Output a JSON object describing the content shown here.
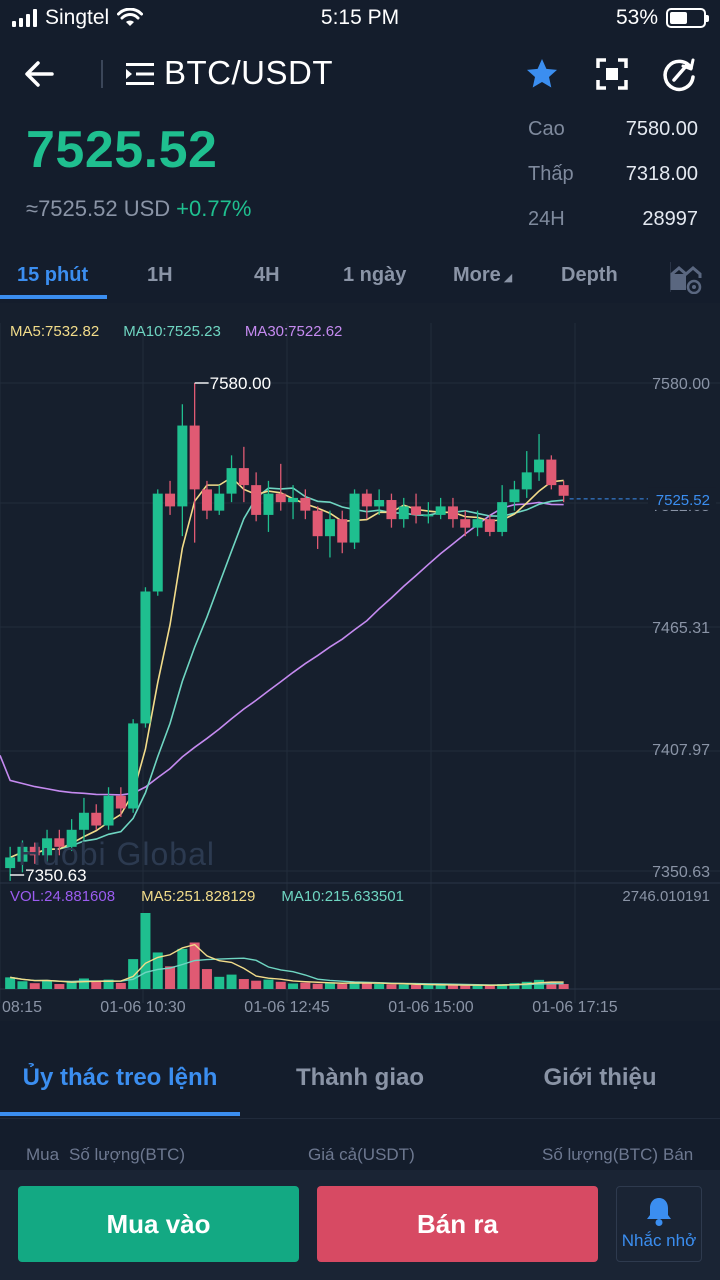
{
  "status_bar": {
    "carrier": "Singtel",
    "time": "5:15 PM",
    "battery": "53%",
    "battery_level": 0.53
  },
  "header": {
    "pair": "BTC/USDT",
    "favorited": true
  },
  "ticker": {
    "price": "7525.52",
    "usd_value": "≈7525.52 USD",
    "change": "+0.77%",
    "stats": [
      {
        "label": "Cao",
        "value": "7580.00"
      },
      {
        "label": "Thấp",
        "value": "7318.00"
      },
      {
        "label": "24H",
        "value": "28997"
      }
    ]
  },
  "tabs": [
    "15 phút",
    "1H",
    "4H",
    "1 ngày",
    "More",
    "Depth"
  ],
  "active_tab": 0,
  "chart": {
    "ma_legend": {
      "ma5": "MA5:7532.82",
      "ma10": "MA10:7525.23",
      "ma30": "MA30:7522.62"
    },
    "vol_legend": {
      "vol": "VOL:24.881608",
      "ma5": "MA5:251.828129",
      "ma10": "MA10:215.633501"
    },
    "vol_max": "2746.010191",
    "watermark": "Huobi Global",
    "high_marker": "7580.00",
    "low_marker": "7350.63",
    "current_price_label": "7525.52",
    "colors": {
      "up": "#1fbf8f",
      "down": "#e05a73",
      "ma5": "#f2dc8a",
      "ma10": "#6fd6c2",
      "ma30": "#c58af0",
      "vol": "#9b5cf0"
    }
  },
  "chart_data": {
    "type": "candlestick",
    "title": "",
    "y_axis_ticks": [
      "7580.00",
      "7522.65",
      "7465.31",
      "7407.97",
      "7350.63"
    ],
    "y_axis_values": [
      7580.0,
      7522.65,
      7465.31,
      7407.97,
      7350.63
    ],
    "ylim": [
      7350.63,
      7580.0
    ],
    "x_axis_ticks": [
      "08:15",
      "01-06 10:30",
      "01-06 12:45",
      "01-06 15:00",
      "01-06 17:15"
    ],
    "candles": [
      [
        7352,
        7357,
        7346,
        7362
      ],
      [
        7355,
        7362,
        7350,
        7365
      ],
      [
        7362,
        7358,
        7354,
        7364
      ],
      [
        7358,
        7366,
        7355,
        7370
      ],
      [
        7366,
        7362,
        7358,
        7370
      ],
      [
        7362,
        7370,
        7360,
        7375
      ],
      [
        7370,
        7378,
        7365,
        7385
      ],
      [
        7378,
        7372,
        7370,
        7382
      ],
      [
        7372,
        7386,
        7370,
        7390
      ],
      [
        7386,
        7380,
        7376,
        7390
      ],
      [
        7380,
        7420,
        7378,
        7422
      ],
      [
        7420,
        7482,
        7418,
        7484
      ],
      [
        7482,
        7528,
        7480,
        7530
      ],
      [
        7528,
        7522,
        7518,
        7534
      ],
      [
        7522,
        7560,
        7508,
        7570
      ],
      [
        7560,
        7530,
        7505,
        7580
      ],
      [
        7530,
        7520,
        7516,
        7534
      ],
      [
        7520,
        7528,
        7518,
        7532
      ],
      [
        7528,
        7540,
        7524,
        7546
      ],
      [
        7540,
        7532,
        7524,
        7550
      ],
      [
        7532,
        7518,
        7515,
        7538
      ],
      [
        7518,
        7528,
        7510,
        7534
      ],
      [
        7528,
        7524,
        7520,
        7542
      ],
      [
        7524,
        7526,
        7516,
        7532
      ],
      [
        7526,
        7520,
        7516,
        7530
      ],
      [
        7520,
        7508,
        7502,
        7522
      ],
      [
        7508,
        7516,
        7498,
        7520
      ],
      [
        7516,
        7505,
        7500,
        7520
      ],
      [
        7505,
        7528,
        7502,
        7530
      ],
      [
        7528,
        7522,
        7516,
        7530
      ],
      [
        7522,
        7525,
        7518,
        7530
      ],
      [
        7525,
        7516,
        7512,
        7528
      ],
      [
        7516,
        7522,
        7512,
        7526
      ],
      [
        7522,
        7518,
        7514,
        7528
      ],
      [
        7518,
        7518,
        7514,
        7524
      ],
      [
        7518,
        7522,
        7516,
        7526
      ],
      [
        7522,
        7516,
        7512,
        7526
      ],
      [
        7516,
        7512,
        7508,
        7520
      ],
      [
        7512,
        7516,
        7508,
        7520
      ],
      [
        7516,
        7510,
        7508,
        7518
      ],
      [
        7510,
        7524,
        7508,
        7532
      ],
      [
        7524,
        7530,
        7520,
        7534
      ],
      [
        7530,
        7538,
        7526,
        7548
      ],
      [
        7538,
        7544,
        7534,
        7556
      ],
      [
        7544,
        7532,
        7530,
        7546
      ],
      [
        7532,
        7527,
        7524,
        7534
      ]
    ],
    "volumes": [
      420,
      280,
      210,
      320,
      180,
      240,
      380,
      260,
      340,
      220,
      1080,
      2746,
      1320,
      820,
      1450,
      1680,
      720,
      440,
      520,
      360,
      300,
      340,
      260,
      200,
      230,
      190,
      240,
      180,
      260,
      200,
      180,
      170,
      160,
      150,
      140,
      150,
      130,
      120,
      140,
      130,
      180,
      210,
      260,
      330,
      260,
      180
    ]
  },
  "order_tabs": [
    "Ủy thác treo lệnh",
    "Thành giao",
    "Giới thiệu"
  ],
  "order_headers": {
    "buy": "Mua",
    "qty_left": "Số lượng(BTC)",
    "price": "Giá cả(USDT)",
    "qty_right": "Số lượng(BTC)",
    "sell": "Bán"
  },
  "actions": {
    "buy": "Mua vào",
    "sell": "Bán ra",
    "remind": "Nhắc nhở"
  }
}
